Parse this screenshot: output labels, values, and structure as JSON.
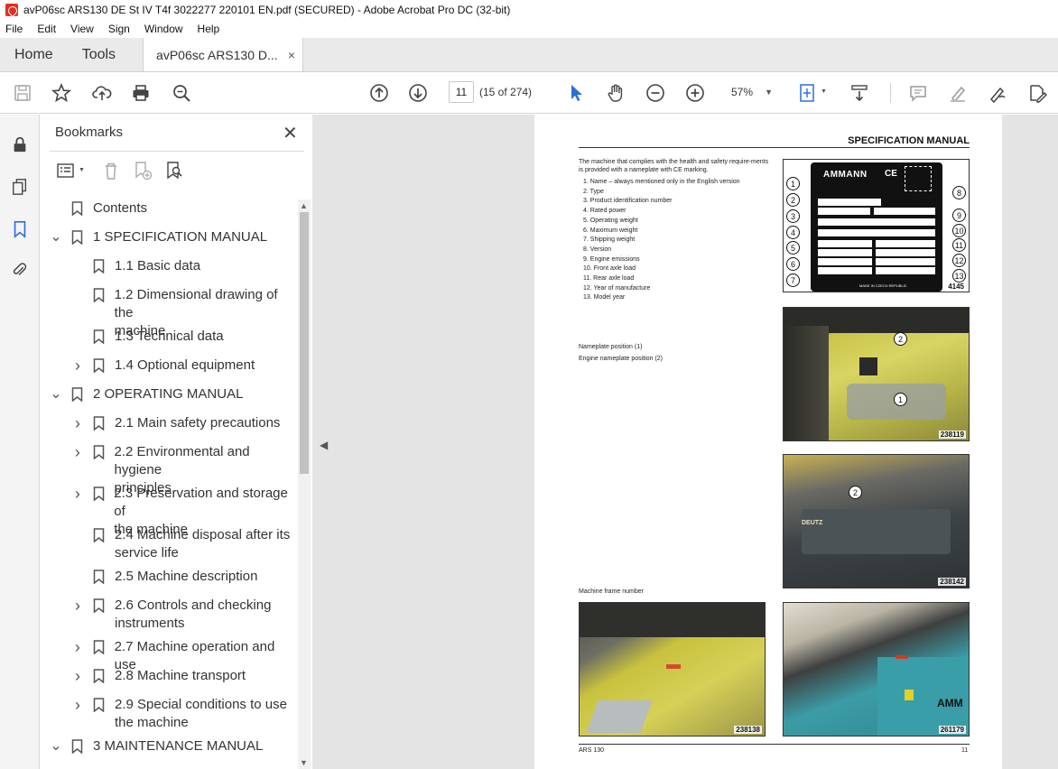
{
  "window": {
    "title": "avP06sc ARS130 DE St IV T4f 3022277 220101 EN.pdf (SECURED) - Adobe Acrobat Pro DC (32-bit)"
  },
  "menu": [
    "File",
    "Edit",
    "View",
    "Sign",
    "Window",
    "Help"
  ],
  "tabs": {
    "home": "Home",
    "tools": "Tools",
    "document": "avP06sc ARS130 D...",
    "close": "×"
  },
  "toolbar": {
    "page_number": "11",
    "page_count": "(15 of 274)",
    "zoom": "57%"
  },
  "bookmarks": {
    "title": "Bookmarks",
    "close": "✕",
    "items": [
      {
        "label": "Contents",
        "level": 0,
        "expander": false
      },
      {
        "label": "1 SPECIFICATION MANUAL",
        "level": 0,
        "expander": "open"
      },
      {
        "label": "1.1 Basic data",
        "level": 1,
        "expander": false
      },
      {
        "label": "1.2 Dimensional drawing of the",
        "label2": "machine",
        "level": 1,
        "expander": false
      },
      {
        "label": "1.3 Technical data",
        "level": 1,
        "expander": false
      },
      {
        "label": "1.4 Optional equipment",
        "level": 1,
        "expander": "closed"
      },
      {
        "label": "2 OPERATING MANUAL",
        "level": 0,
        "expander": "open"
      },
      {
        "label": "2.1 Main safety precautions",
        "level": 1,
        "expander": "closed"
      },
      {
        "label": "2.2 Environmental and hygiene",
        "label2": "principles",
        "level": 1,
        "expander": "closed"
      },
      {
        "label": "2.3 Preservation and storage of",
        "label2": "the machine",
        "level": 1,
        "expander": "closed"
      },
      {
        "label": "2.4 Machine disposal after its",
        "label2": "service life",
        "level": 1,
        "expander": false
      },
      {
        "label": "2.5 Machine description",
        "level": 1,
        "expander": false
      },
      {
        "label": "2.6 Controls and checking",
        "label2": "instruments",
        "level": 1,
        "expander": "closed"
      },
      {
        "label": "2.7 Machine operation and use",
        "level": 1,
        "expander": "closed"
      },
      {
        "label": "2.8 Machine transport",
        "level": 1,
        "expander": "closed"
      },
      {
        "label": "2.9 Special conditions to use",
        "label2": "the machine",
        "level": 1,
        "expander": "closed"
      },
      {
        "label": "3 MAINTENANCE MANUAL",
        "level": 0,
        "expander": "open"
      }
    ]
  },
  "document": {
    "header": "SPECIFICATION MANUAL",
    "intro": "The machine that complies with the health and safety require-ments is provided with a nameplate with CE marking.",
    "list": [
      "1. Name – always mentioned only in the English version",
      "2. Type",
      "3. Product identification number",
      "4. Rated power",
      "5. Operating weight",
      "6. Maximum weight",
      "7. Shipping weight",
      "8. Version",
      "9. Engine emissions",
      "10. Front axle load",
      "11. Rear axle load",
      "12. Year of manufacture",
      "13. Model year"
    ],
    "caption_nameplate_1": "Nameplate position (1)",
    "caption_nameplate_2": "Engine nameplate position (2)",
    "caption_frame": "Machine frame number",
    "fig_ids": [
      "4145",
      "238119",
      "238142",
      "238138",
      "261179"
    ],
    "plate_brand": "AMMANN",
    "plate_ce": "CE",
    "plate_made": "MADE IN CZECH REPUBLIC",
    "plate_callouts": [
      "1",
      "2",
      "3",
      "4",
      "5",
      "6",
      "7",
      "8",
      "9",
      "10",
      "11",
      "12",
      "13"
    ],
    "photo_callouts": [
      "2",
      "1",
      "2"
    ],
    "engine_brand": "DEUTZ",
    "side_brand": "AMM",
    "footer_left": "ARS 130",
    "footer_right": "11"
  }
}
